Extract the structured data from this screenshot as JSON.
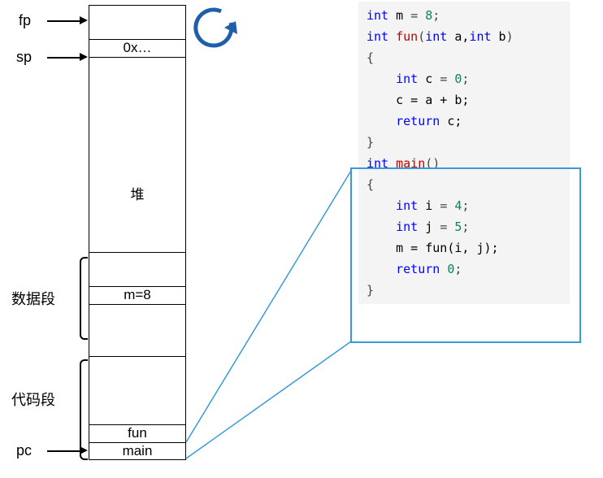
{
  "pointers": {
    "fp": "fp",
    "sp": "sp",
    "pc": "pc"
  },
  "sections": {
    "data_segment": "数据段",
    "code_segment": "代码段",
    "heap": "堆"
  },
  "memory": {
    "empty_top": "",
    "saved_addr": "0x…",
    "gap1": "",
    "heap_label": "堆",
    "gap2": "",
    "m_var": "m=8",
    "gap3": "",
    "gap4": "",
    "fun_slot": "fun",
    "main_slot": "main"
  },
  "code": {
    "l1_kw_int": "int",
    "l1_var": " m ",
    "l1_eq": "=",
    "l1_num": " 8",
    "l1_semi": ";",
    "l2_kw_int": "int",
    "l2_fn": " fun",
    "l2_open": "(",
    "l2_ty1": "int",
    "l2_a": " a,",
    "l2_ty2": "int",
    "l2_b": " b",
    "l2_close": ")",
    "l3_brace": "{",
    "l4_ind": "    ",
    "l4_kw_int": "int",
    "l4_c": " c ",
    "l4_eq": "=",
    "l4_num": " 0",
    "l4_semi": ";",
    "l5_ind": "    ",
    "l5_expr": "c = a + b;",
    "l6_ind": "    ",
    "l6_kw": "return",
    "l6_rest": " c;",
    "l7_brace": "}",
    "l8_kw_int": "int",
    "l8_fn": " main",
    "l8_parens": "()",
    "l9_brace": "{",
    "l10_ind": "    ",
    "l10_kw_int": "int",
    "l10_i": " i ",
    "l10_eq": "=",
    "l10_num": " 4",
    "l10_semi": ";",
    "l11_ind": "    ",
    "l11_kw_int": "int",
    "l11_j": " j ",
    "l11_eq": "=",
    "l11_num": " 5",
    "l11_semi": ";",
    "l12_ind": "    ",
    "l12_expr": "m = fun(i, j);",
    "l13_ind": "    ",
    "l13_kw": "return",
    "l13_num": " 0",
    "l13_semi": ";",
    "l14_brace": "}"
  }
}
